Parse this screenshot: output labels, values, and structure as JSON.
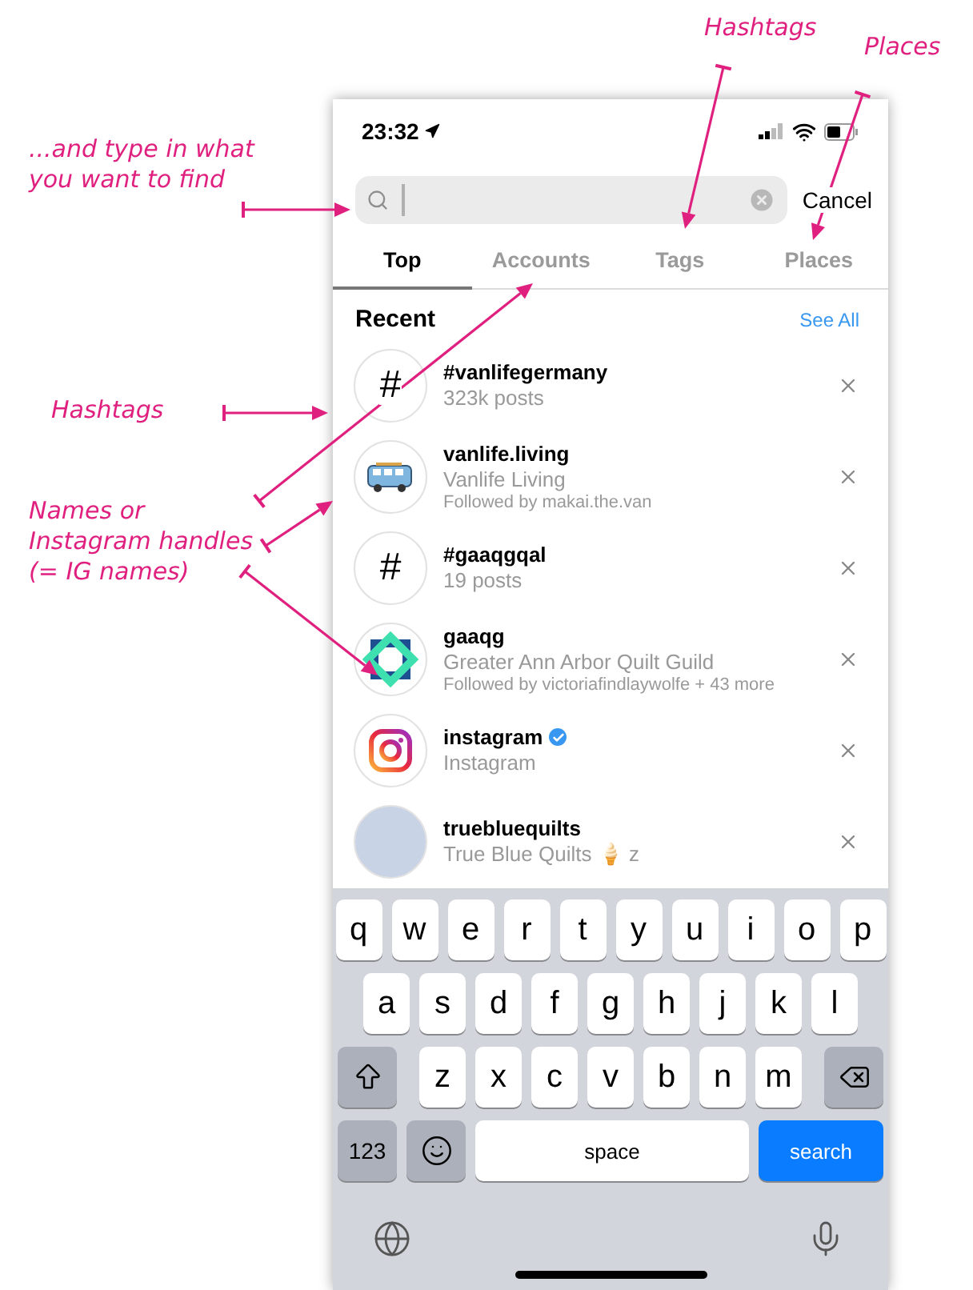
{
  "annotations": [
    {
      "lines": [
        "Hashtags"
      ]
    },
    {
      "lines": [
        "Places"
      ]
    },
    {
      "lines": [
        "...and type in what",
        "you want to find"
      ]
    },
    {
      "lines": [
        "Hashtags"
      ]
    },
    {
      "lines": [
        "Names or",
        "Instagram handles",
        "(= IG names)"
      ]
    }
  ],
  "status_bar": {
    "time": "23:32"
  },
  "search": {
    "cancel": "Cancel"
  },
  "tabs": [
    {
      "label": "Top",
      "selected": true
    },
    {
      "label": "Accounts",
      "selected": false
    },
    {
      "label": "Tags",
      "selected": false
    },
    {
      "label": "Places",
      "selected": false
    }
  ],
  "recent": {
    "title": "Recent",
    "see_all": "See All"
  },
  "rows": [
    {
      "kind": "hashtag",
      "glyph": "#",
      "title": "#vanlifegermany",
      "subtitle": "323k posts"
    },
    {
      "kind": "van",
      "title": "vanlife.living",
      "subtitle": "Vanlife Living",
      "detail": "Followed by makai.the.van",
      "verified": false
    },
    {
      "kind": "hashtag",
      "glyph": "#",
      "title": "#gaaqgqal",
      "subtitle": "19 posts"
    },
    {
      "kind": "logo",
      "title": "gaaqg",
      "subtitle": "Greater Ann Arbor Quilt Guild",
      "detail": "Followed by victoriafindlaywolfe + 43 more",
      "verified": false
    },
    {
      "kind": "camera",
      "title": "instagram",
      "subtitle": "Instagram",
      "verified": true
    },
    {
      "kind": "photo",
      "title": "truebluequilts",
      "subtitle": "True Blue Quilts 🍦 z",
      "verified": false
    }
  ],
  "keyboard": {
    "rows": [
      {
        "keys": [
          {
            "kind": "letter",
            "label": "q"
          },
          {
            "kind": "letter",
            "label": "w"
          },
          {
            "kind": "letter",
            "label": "e"
          },
          {
            "kind": "letter",
            "label": "r"
          },
          {
            "kind": "letter",
            "label": "t"
          },
          {
            "kind": "letter",
            "label": "y"
          },
          {
            "kind": "letter",
            "label": "u"
          },
          {
            "kind": "letter",
            "label": "i"
          },
          {
            "kind": "letter",
            "label": "o"
          },
          {
            "kind": "letter",
            "label": "p"
          }
        ]
      },
      {
        "keys": [
          {
            "kind": "letter",
            "label": "a"
          },
          {
            "kind": "letter",
            "label": "s"
          },
          {
            "kind": "letter",
            "label": "d"
          },
          {
            "kind": "letter",
            "label": "f"
          },
          {
            "kind": "letter",
            "label": "g"
          },
          {
            "kind": "letter",
            "label": "h"
          },
          {
            "kind": "letter",
            "label": "j"
          },
          {
            "kind": "letter",
            "label": "k"
          },
          {
            "kind": "letter",
            "label": "l"
          }
        ]
      },
      {
        "keys": [
          {
            "kind": "shift"
          },
          {
            "kind": "letter",
            "label": "z"
          },
          {
            "kind": "letter",
            "label": "x"
          },
          {
            "kind": "letter",
            "label": "c"
          },
          {
            "kind": "letter",
            "label": "v"
          },
          {
            "kind": "letter",
            "label": "b"
          },
          {
            "kind": "letter",
            "label": "n"
          },
          {
            "kind": "letter",
            "label": "m"
          },
          {
            "kind": "delete"
          }
        ]
      },
      {
        "keys": [
          {
            "kind": "numbers",
            "label": "123"
          },
          {
            "kind": "emoji"
          },
          {
            "kind": "space",
            "label": "space"
          },
          {
            "kind": "search",
            "label": "search"
          }
        ]
      }
    ]
  }
}
